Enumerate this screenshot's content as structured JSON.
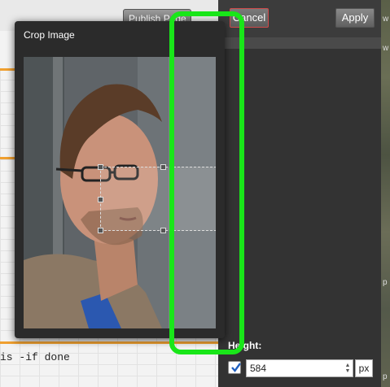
{
  "editor": {
    "publish_label": "Publish Page",
    "code_line": "is -if done"
  },
  "panel": {
    "cancel_label": "Cancel",
    "apply_label": "Apply",
    "height_label": "Height:",
    "height_value": "584",
    "height_unit": "px",
    "lock_checked": true
  },
  "crop_dialog": {
    "title": "Crop Image"
  },
  "map": {
    "letters": [
      "w",
      "w",
      "p",
      "p"
    ]
  },
  "colors": {
    "annotation": "#19e619",
    "cancel_border": "#d04a4a",
    "dark_panel": "#333333"
  }
}
